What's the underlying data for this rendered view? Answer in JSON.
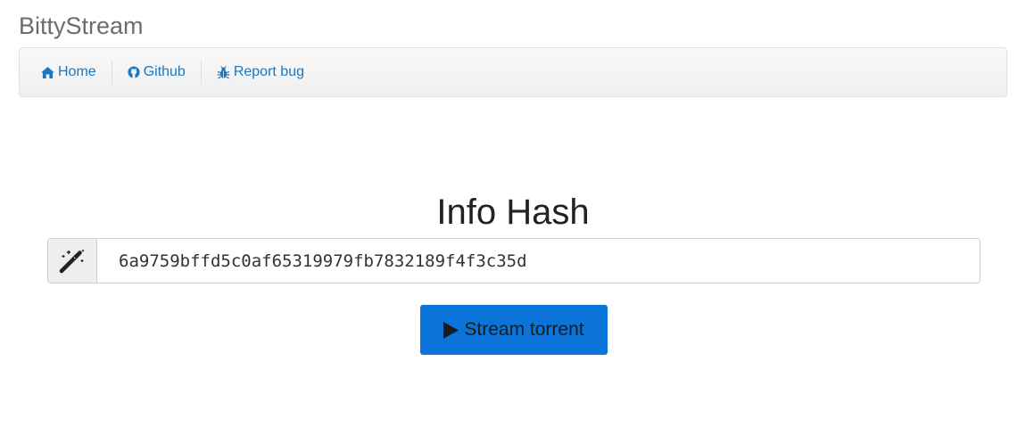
{
  "header": {
    "brand": "BittyStream"
  },
  "nav": {
    "items": [
      {
        "label": "Home",
        "icon": "home-icon"
      },
      {
        "label": "Github",
        "icon": "github-icon"
      },
      {
        "label": "Report bug",
        "icon": "bug-icon"
      }
    ]
  },
  "main": {
    "title": "Info Hash",
    "input_value": "6a9759bffd5c0af65319979fb7832189f4f3c35d",
    "input_icon": "magic-wand-icon",
    "button_label": "Stream torrent",
    "button_icon": "play-icon"
  },
  "colors": {
    "link": "#1a78c2",
    "button": "#0a74da"
  }
}
